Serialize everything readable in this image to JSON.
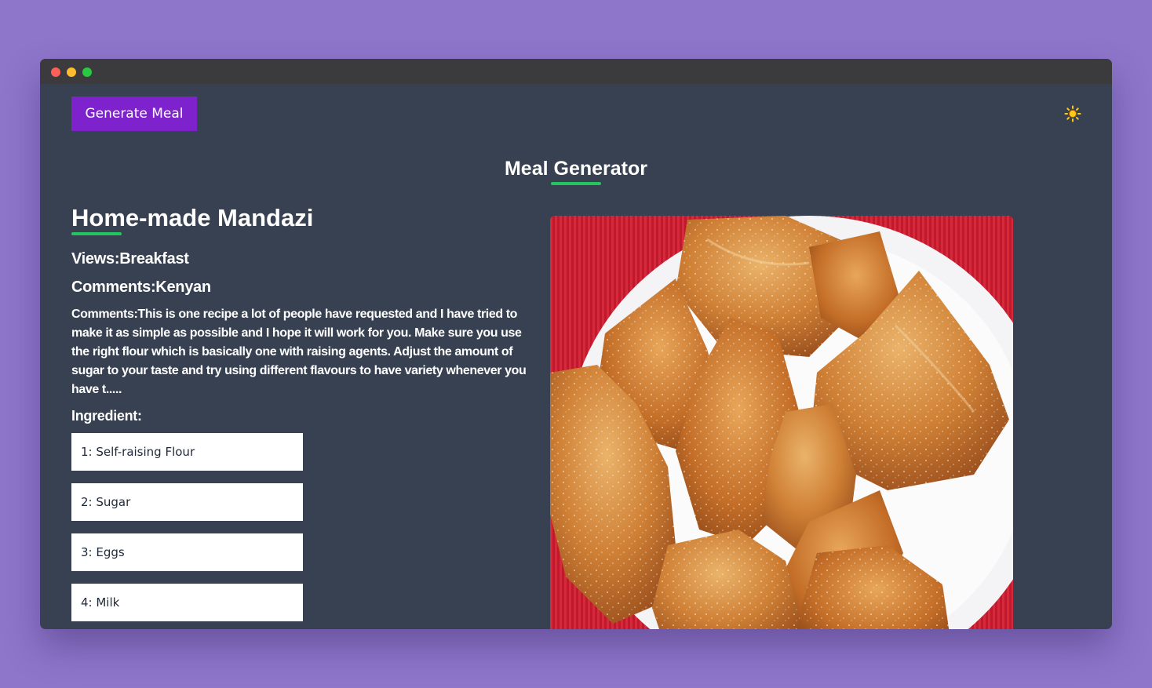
{
  "toolbar": {
    "generate_label": "Generate Meal",
    "theme_icon": "sun-icon",
    "theme_icon_color": "#facc15"
  },
  "header": {
    "title": "Meal Generator"
  },
  "meal": {
    "name": "Home-made Mandazi",
    "views_line": "Views:Breakfast",
    "area_line": "Comments:Kenyan",
    "description": "Comments:This is one recipe a lot of people have requested and I have tried to make it as simple as possible and I hope it will work for you. Make sure you use the right flour which is basically one with raising agents. Adjust the amount of sugar to your taste and try using different flavours to have variety whenever you have t.....",
    "ingredient_heading": "Ingredient:",
    "ingredients": [
      {
        "label": "1: Self-raising Flour"
      },
      {
        "label": "2: Sugar"
      },
      {
        "label": "3: Eggs"
      },
      {
        "label": "4: Milk"
      }
    ]
  },
  "colors": {
    "page_background": "#8e76cb",
    "app_background": "#374151",
    "titlebar": "#3b3b3d",
    "button": "#7e22ce",
    "accent_underline": "#22c55e"
  }
}
